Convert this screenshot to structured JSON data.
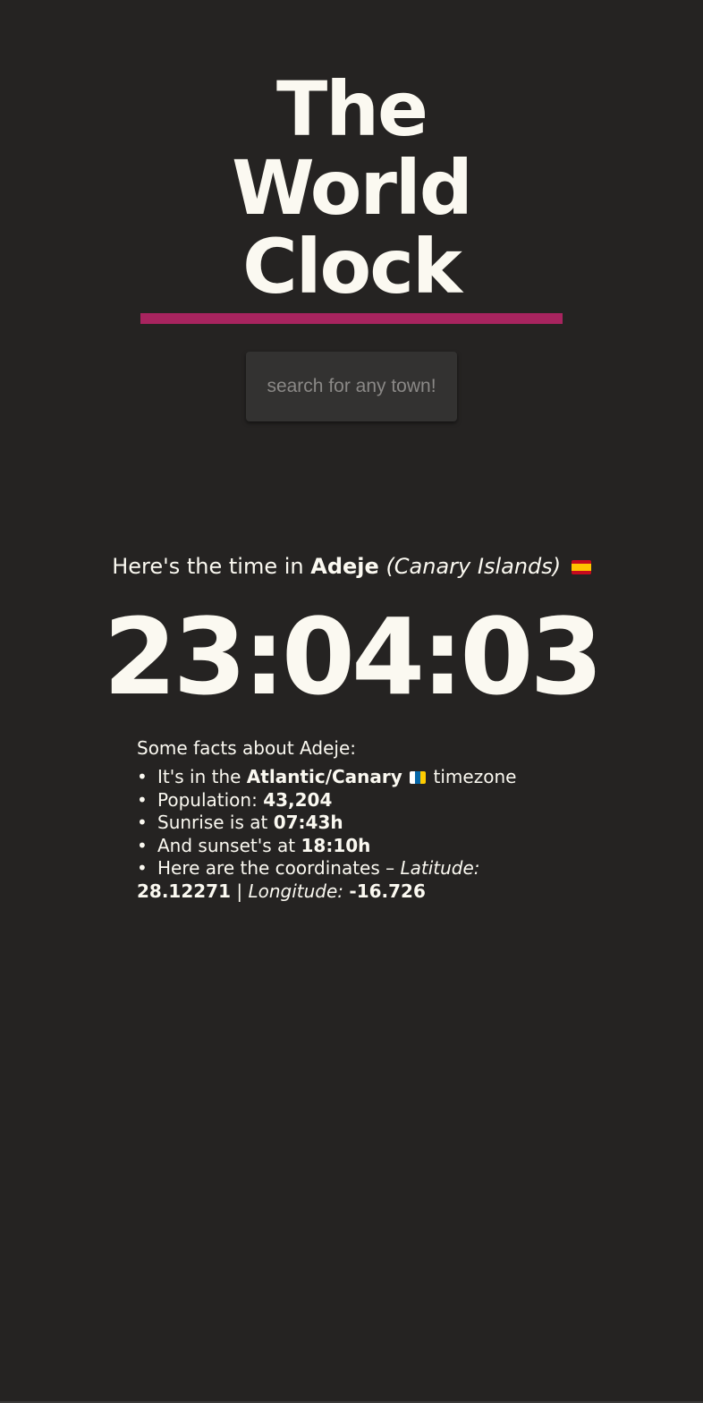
{
  "header": {
    "title_lines": [
      "The",
      "World",
      "Clock"
    ]
  },
  "search": {
    "placeholder": "search for any town!",
    "value": ""
  },
  "location": {
    "intro_prefix": "Here's the time in",
    "town": "Adeje",
    "region": "(Canary Islands)",
    "country_flag": "spain-flag-icon"
  },
  "clock": {
    "time": "23:04:03"
  },
  "facts": {
    "heading": "Some facts about Adeje:",
    "timezone_prefix": "It's in the",
    "timezone": "Atlantic/Canary",
    "timezone_flag": "canary-islands-flag-icon",
    "timezone_suffix": "timezone",
    "population_label": "Population:",
    "population": "43,204",
    "sunrise_label": "Sunrise is at",
    "sunrise": "07:43h",
    "sunset_label": "And sunset's at",
    "sunset": "18:10h",
    "coords_prefix": "Here are the coordinates –",
    "latitude_label": "Latitude:",
    "latitude": "28.12271",
    "separator": "|",
    "longitude_label": "Longitude:",
    "longitude": "-16.726"
  },
  "colors": {
    "background": "#252322",
    "text": "#fbf9f1",
    "accent": "#a8245f",
    "search_bg": "#333231"
  }
}
